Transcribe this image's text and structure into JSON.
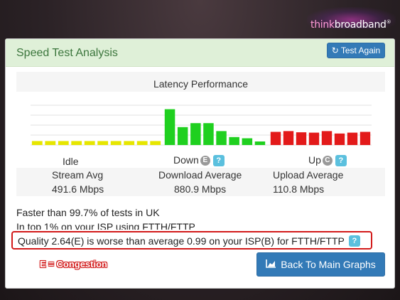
{
  "logo": {
    "think": "think",
    "broad": "broadband",
    "reg": "®"
  },
  "panel": {
    "title": "Speed Test Analysis",
    "test_again_label": "Test Again",
    "refresh_icon": "refresh-icon"
  },
  "chart_data": {
    "type": "bar",
    "title": "Latency Performance",
    "groups": [
      {
        "name": "Idle",
        "color": "#e6e600",
        "values": [
          1,
          1,
          1,
          1,
          1,
          1,
          1,
          1,
          1,
          1
        ]
      },
      {
        "name": "Down",
        "color": "#1fd01f",
        "values": [
          9,
          4.5,
          5.5,
          5.5,
          3.5,
          2,
          1.7,
          0.9
        ]
      },
      {
        "name": "Up",
        "color": "#e31a1a",
        "values": [
          3.3,
          3.5,
          3.2,
          3.1,
          3.5,
          2.9,
          3.1,
          3.3
        ]
      }
    ],
    "ylim": [
      0,
      10
    ],
    "grid": true
  },
  "labels": {
    "idle": "Idle",
    "down": "Down",
    "up": "Up",
    "down_badge": "E",
    "up_badge": "C",
    "help": "?"
  },
  "stats": {
    "stream_label": "Stream Avg",
    "stream_value": "491.6 Mbps",
    "download_label": "Download Average",
    "download_value": "880.9 Mbps",
    "upload_label": "Upload Average",
    "upload_value": "110.8 Mbps"
  },
  "lines": {
    "faster": "Faster than 99.7% of tests in UK",
    "top": "In top 1% on your ISP using FTTH/FTTP",
    "quality": "Quality 2.64(E) is worse than average 0.99 on your ISP(B) for FTTH/FTTP"
  },
  "annotation": {
    "congestion": "E = Congestion"
  },
  "back_button": {
    "label": "Back To Main Graphs",
    "icon": "area-chart-icon"
  }
}
